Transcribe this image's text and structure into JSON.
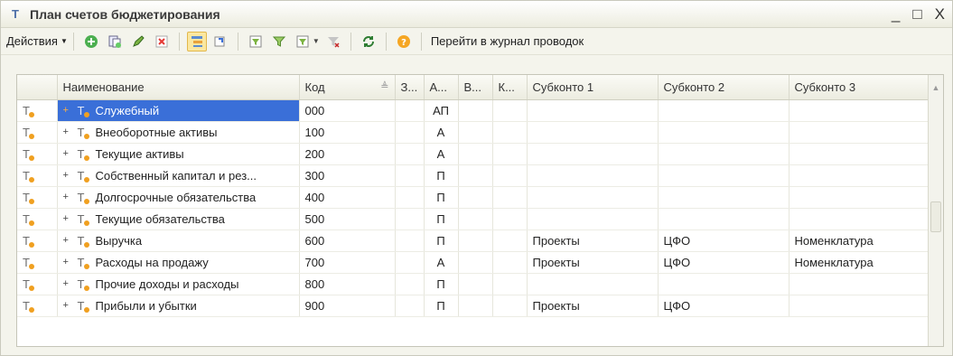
{
  "window": {
    "title": "План счетов бюджетирования",
    "minimize": "_",
    "maximize": "□",
    "close": "X"
  },
  "toolbar": {
    "actions_label": "Действия",
    "journal_link": "Перейти в журнал проводок",
    "icons": [
      "add-icon",
      "copy-icon",
      "edit-icon",
      "delete-icon",
      "hierarchy-icon",
      "parent-icon",
      "filter-icon",
      "filter-value-icon",
      "filter-list-icon",
      "clear-filter-icon",
      "refresh-icon",
      "help-icon"
    ]
  },
  "table": {
    "headers": {
      "name": "Наименование",
      "code": "Код",
      "z": "З...",
      "a": "А...",
      "v": "В...",
      "k": "К...",
      "sub1": "Субконто 1",
      "sub2": "Субконто 2",
      "sub3": "Субконто 3"
    },
    "rows": [
      {
        "name": "Служебный",
        "code": "000",
        "a": "АП",
        "sub1": "",
        "sub2": "",
        "sub3": ""
      },
      {
        "name": "Внеоборотные активы",
        "code": "100",
        "a": "А",
        "sub1": "",
        "sub2": "",
        "sub3": ""
      },
      {
        "name": "Текущие активы",
        "code": "200",
        "a": "А",
        "sub1": "",
        "sub2": "",
        "sub3": ""
      },
      {
        "name": "Собственный капитал и рез...",
        "code": "300",
        "a": "П",
        "sub1": "",
        "sub2": "",
        "sub3": ""
      },
      {
        "name": "Долгосрочные обязательства",
        "code": "400",
        "a": "П",
        "sub1": "",
        "sub2": "",
        "sub3": ""
      },
      {
        "name": "Текущие обязательства",
        "code": "500",
        "a": "П",
        "sub1": "",
        "sub2": "",
        "sub3": ""
      },
      {
        "name": "Выручка",
        "code": "600",
        "a": "П",
        "sub1": "Проекты",
        "sub2": "ЦФО",
        "sub3": "Номенклатура"
      },
      {
        "name": "Расходы на продажу",
        "code": "700",
        "a": "А",
        "sub1": "Проекты",
        "sub2": "ЦФО",
        "sub3": "Номенклатура"
      },
      {
        "name": "Прочие доходы и расходы",
        "code": "800",
        "a": "П",
        "sub1": "",
        "sub2": "",
        "sub3": ""
      },
      {
        "name": "Прибыли и убытки",
        "code": "900",
        "a": "П",
        "sub1": "Проекты",
        "sub2": "ЦФО",
        "sub3": ""
      }
    ],
    "selected_row": 0
  },
  "colors": {
    "selection": "#3a6fd8",
    "row_icon_dot": "#f0a020"
  }
}
